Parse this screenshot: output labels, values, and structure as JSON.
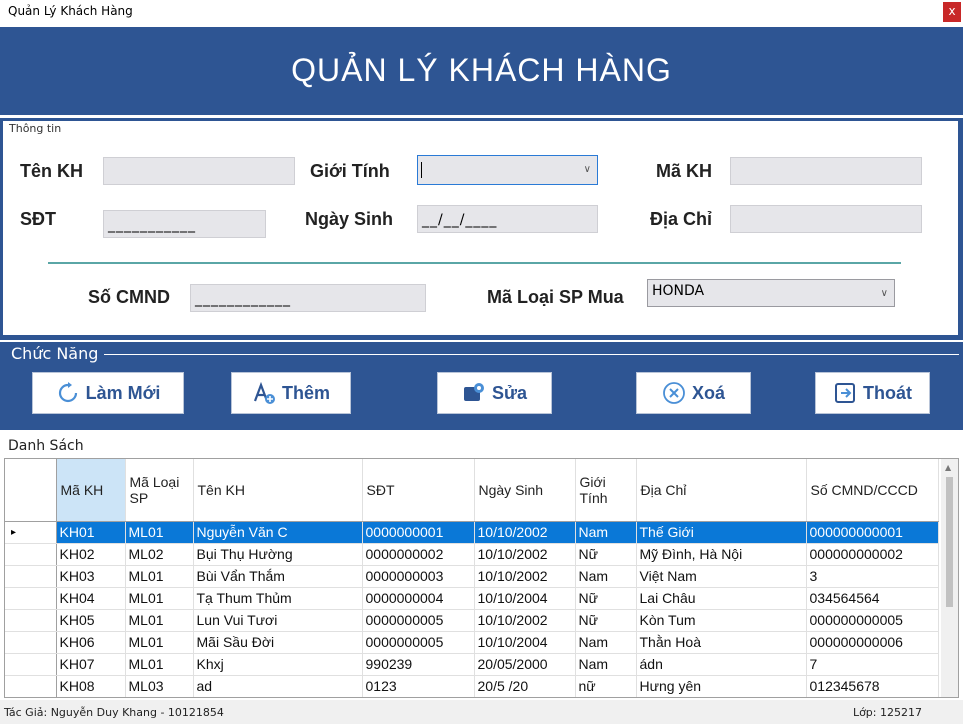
{
  "window": {
    "title": "Quản Lý Khách Hàng",
    "close_glyph": "x"
  },
  "header": {
    "title": "QUẢN LÝ KHÁCH HÀNG"
  },
  "info": {
    "group_label": "Thông tin",
    "ten_kh_label": "Tên KH",
    "gioi_tinh_label": "Giới Tính",
    "ma_kh_label": "Mã KH",
    "sdt_label": "SĐT",
    "sdt_mask": "___________",
    "ngay_sinh_label": "Ngày Sinh",
    "ngay_sinh_mask": "__/__/____",
    "dia_chi_label": "Địa Chỉ",
    "so_cmnd_label": "Số CMND",
    "so_cmnd_mask": "____________",
    "ma_loai_sp_label": "Mã Loại SP Mua",
    "ma_loai_sp_value": "HONDA"
  },
  "functions": {
    "group_label": "Chức Năng",
    "lam_moi": "Làm Mới",
    "them": "Thêm",
    "sua": "Sửa",
    "xoa": "Xoá",
    "thoat": "Thoát"
  },
  "list": {
    "label": "Danh Sách",
    "columns": [
      "Mã KH",
      "Mã Loại SP",
      "Tên KH",
      "SĐT",
      "Ngày Sinh",
      "Giới Tính",
      "Địa Chỉ",
      "Số CMND/CCCD"
    ],
    "rows": [
      [
        "KH01",
        "ML01",
        "Nguyễn Văn C",
        "0000000001",
        "10/10/2002",
        "Nam",
        "Thế Giới",
        "000000000001"
      ],
      [
        "KH02",
        "ML02",
        "Bụi Thụ Hường",
        "0000000002",
        "10/10/2002",
        "Nữ",
        "Mỹ Đình, Hà Nội",
        "000000000002"
      ],
      [
        "KH03",
        "ML01",
        "Bùi Vẩn Thắm",
        "0000000003",
        "10/10/2002",
        "Nam",
        "Việt Nam",
        "3"
      ],
      [
        "KH04",
        "ML01",
        "Tạ Thum Thủm",
        "0000000004",
        "10/10/2004",
        "Nữ",
        "Lai Châu",
        "034564564"
      ],
      [
        "KH05",
        "ML01",
        "Lun Vui Tươi",
        "0000000005",
        "10/10/2002",
        "Nữ",
        "Kòn Tum",
        "000000000005"
      ],
      [
        "KH06",
        "ML01",
        "Mãi Sầu Đời",
        "0000000005",
        "10/10/2004",
        "Nam",
        "Thằn Hoà",
        "000000000006"
      ],
      [
        "KH07",
        "ML01",
        "Khxj",
        "990239",
        "20/05/2000",
        "Nam",
        "ádn",
        "7"
      ],
      [
        "KH08",
        "ML03",
        "ad",
        "0123",
        "20/5 /20",
        "nữ",
        "Hưng yên",
        "012345678"
      ]
    ],
    "selected_row_marker": "▸"
  },
  "status": {
    "author": "Tác Giả: Nguyễn Duy Khang - 10121854",
    "class": "Lớp: 125217"
  },
  "colors": {
    "header_bg": "#2e5593",
    "selection": "#0a78d7"
  }
}
